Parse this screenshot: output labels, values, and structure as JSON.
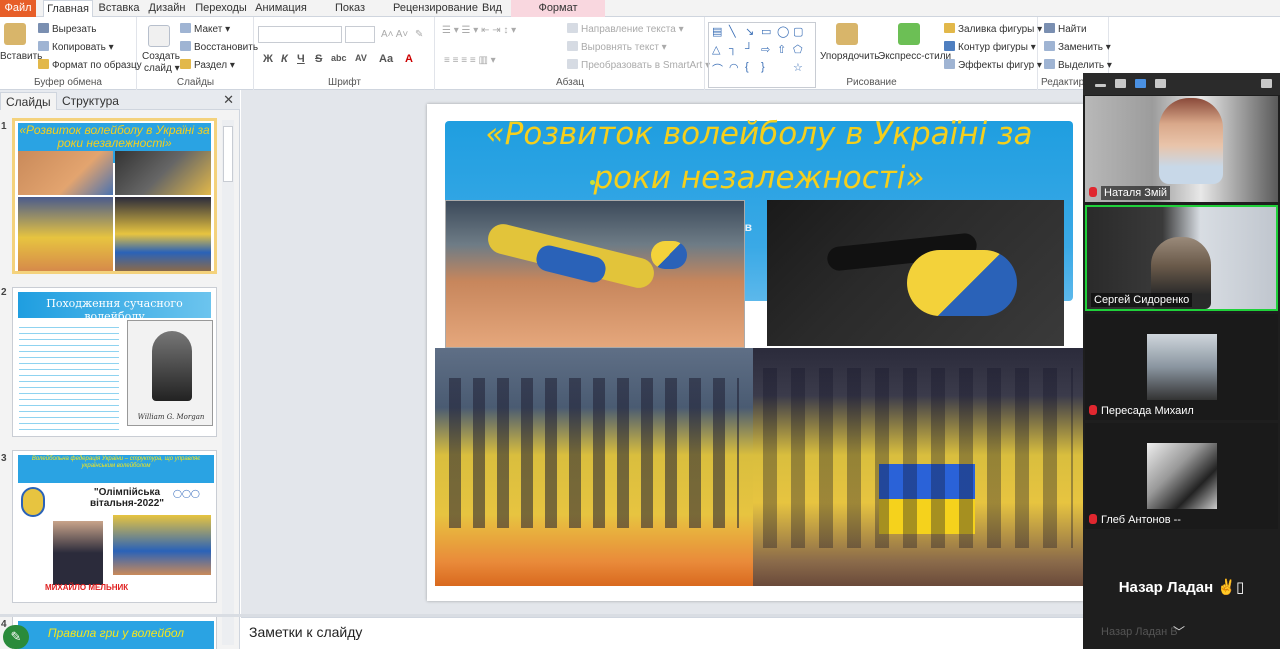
{
  "ribbon_tabs": {
    "file": "Файл",
    "home": "Главная",
    "insert": "Вставка",
    "design": "Дизайн",
    "transitions": "Переходы",
    "animation": "Анимация",
    "slideshow": "Показ слайдов",
    "review": "Рецензирование",
    "view": "Вид",
    "format": "Формат"
  },
  "clipboard": {
    "paste": "Вставить",
    "cut": "Вырезать",
    "copy": "Копировать",
    "format_painter": "Формат по образцу",
    "label": "Буфер обмена"
  },
  "slides_group": {
    "new_slide_1": "Создать",
    "new_slide_2": "слайд",
    "layout": "Макет",
    "reset": "Восстановить",
    "section": "Раздел",
    "label": "Слайды"
  },
  "font_group": {
    "bold": "Ж",
    "italic": "К",
    "underline": "Ч",
    "strike": "S",
    "shadow": "abc",
    "spacing": "AV",
    "case": "Aa",
    "color": "A",
    "label": "Шрифт"
  },
  "paragraph_group": {
    "text_direction": "Направление текста",
    "align_text": "Выровнять текст",
    "smartart": "Преобразовать в SmartArt",
    "label": "Абзац"
  },
  "drawing_group": {
    "arrange": "Упорядочить",
    "quick_styles": "Экспресс-стили",
    "fill": "Заливка фигуры",
    "outline": "Контур фигуры",
    "effects": "Эффекты фигур",
    "label": "Рисование"
  },
  "editing_group": {
    "find": "Найти",
    "replace": "Заменить",
    "select": "Выделить",
    "label": "Редактир"
  },
  "left_panel": {
    "tab_slides": "Слайды",
    "tab_outline": "Структура",
    "close": "✕",
    "thumbs": [
      {
        "num": "1",
        "title": "«Розвиток волейболу в Україні за роки незалежності»"
      },
      {
        "num": "2",
        "title": "Походження сучасного волейболу",
        "caption": "William G. Morgan"
      },
      {
        "num": "3",
        "title": "Волейбольна федерація України – структура, що управляє українським волейболом",
        "banner": "\"Олімпійська вітальня-2022\"",
        "name": "МИХАЙЛО МЕЛЬНИК"
      },
      {
        "num": "4",
        "title": "Правила гри у волейбол"
      }
    ]
  },
  "slide": {
    "title": "«Розвиток волейболу в Україні за роки незалежності»",
    "hidden_text": "нов"
  },
  "notes": {
    "placeholder": "Заметки к слайду"
  },
  "zoom": {
    "participants": [
      {
        "name": "Наталя Змій",
        "muted": true
      },
      {
        "name": "Сергей Сидоренко",
        "muted": false
      },
      {
        "name": "Пересада Михаил",
        "muted": true
      },
      {
        "name": "Глеб Антонов --",
        "muted": true
      }
    ],
    "active_speaker": "Назар Ладан ✌️▯",
    "ghost_name": "Назар Ладан В"
  },
  "colors": {
    "accent": "#e75e28",
    "title_yellow": "#f5cf1c",
    "banner_blue": "#1f9ee0",
    "speaking_green": "#1fd13a",
    "mute_red": "#e0272f"
  }
}
